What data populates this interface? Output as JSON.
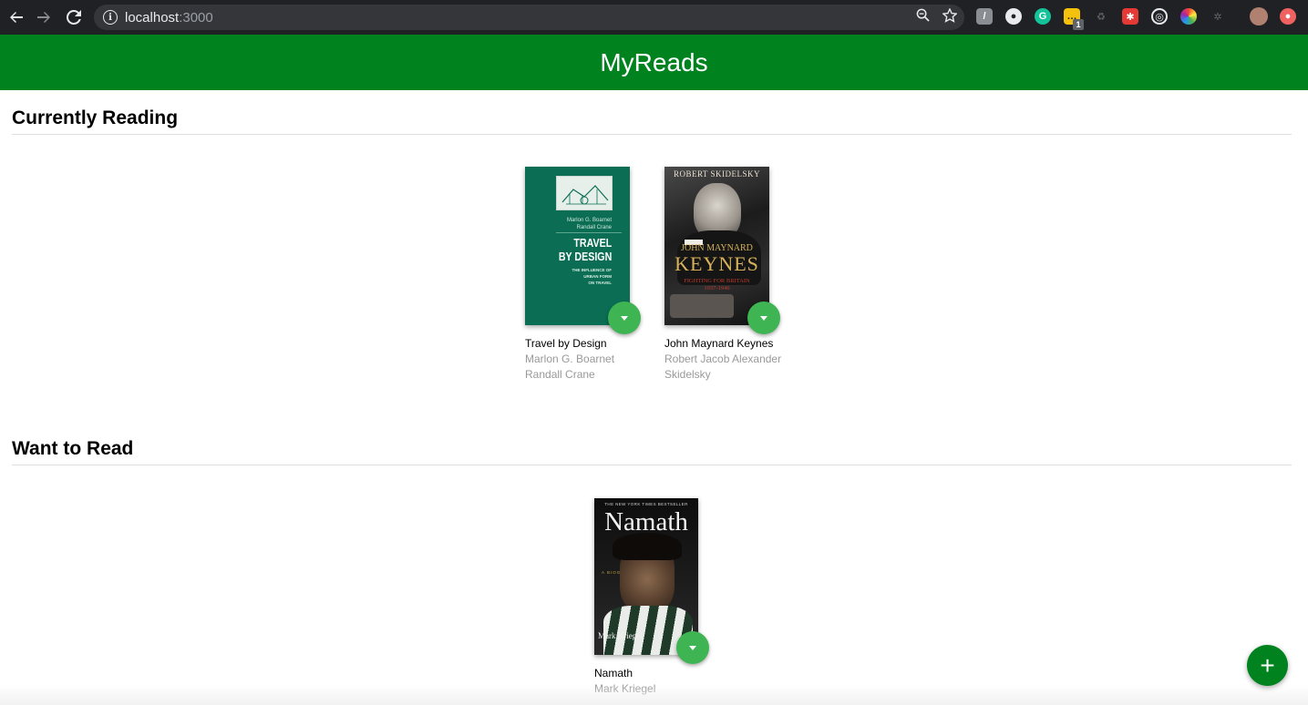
{
  "browser": {
    "url_host": "localhost",
    "url_port": ":3000",
    "extension_badge": "1"
  },
  "app": {
    "title": "MyReads"
  },
  "shelves": [
    {
      "title": "Currently Reading",
      "books": [
        {
          "title": "Travel by Design",
          "authors": [
            "Marlon G. Boarnet",
            "Randall Crane"
          ],
          "cover": {
            "authors_line1": "Marlon G. Boarnet",
            "authors_line2": "Randall Crane",
            "title_line1": "TRAVEL",
            "title_line2": "BY DESIGN",
            "subtitle_line1": "THE INFLUENCE OF",
            "subtitle_line2": "URBAN FORM",
            "subtitle_line3": "ON TRAVEL"
          }
        },
        {
          "title": "John Maynard Keynes",
          "authors": [
            "Robert Jacob Alexander",
            "Skidelsky"
          ],
          "cover": {
            "author": "ROBERT SKIDELSKY",
            "title_line1": "JOHN MAYNARD",
            "title_line2": "KEYNES",
            "subtitle_line1": "FIGHTING FOR BRITAIN",
            "subtitle_line2": "1937-1946"
          }
        }
      ]
    },
    {
      "title": "Want to Read",
      "books": [
        {
          "title": "Namath",
          "authors": [
            "Mark Kriegel"
          ],
          "cover": {
            "banner": "THE NEW YORK TIMES BESTSELLER",
            "title": "Namath",
            "subtitle": "A BIOGRAPHY",
            "author": "Mark Kriegel"
          }
        }
      ]
    }
  ],
  "fab": {
    "label": "+"
  },
  "colors": {
    "header": "#00821f",
    "changer": "#3fb452"
  }
}
